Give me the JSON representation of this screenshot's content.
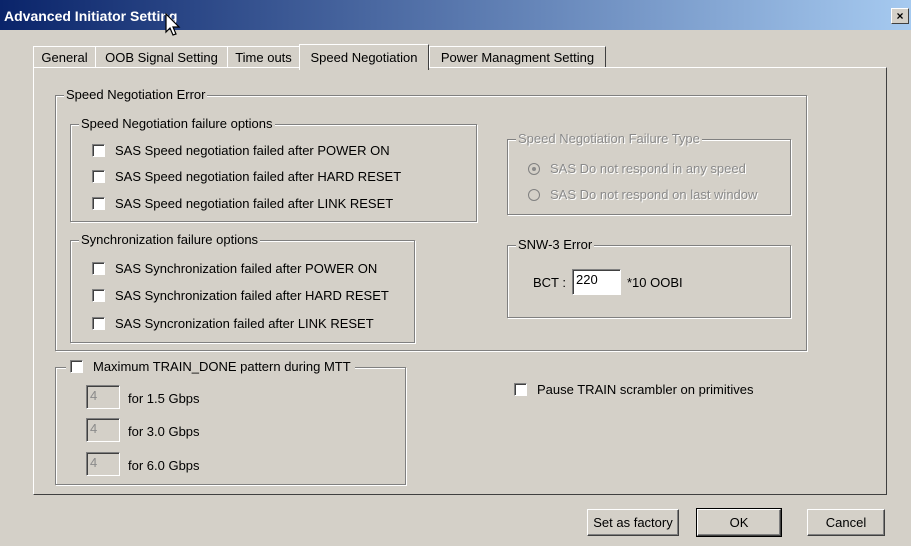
{
  "window": {
    "title": "Advanced Initiator Setting",
    "close_glyph": "×"
  },
  "tabs": [
    {
      "label": "General"
    },
    {
      "label": "OOB Signal Setting"
    },
    {
      "label": "Time outs"
    },
    {
      "label": "Speed Negotiation"
    },
    {
      "label": "Power Managment Setting"
    }
  ],
  "active_tab": "Speed Negotiation",
  "speed_neg_error": {
    "title": "Speed Negotiation Error",
    "failure_options": {
      "title": "Speed Negotiation failure options",
      "items": [
        {
          "label": "SAS Speed negotiation failed after POWER ON",
          "checked": false
        },
        {
          "label": "SAS Speed negotiation failed after HARD RESET",
          "checked": false
        },
        {
          "label": "SAS Speed negotiation failed after LINK RESET",
          "checked": false
        }
      ]
    },
    "failure_type": {
      "title": "Speed Negotiation Failure Type",
      "options": [
        {
          "label": "SAS Do not respond in any speed",
          "selected": true
        },
        {
          "label": "SAS Do not respond on last window",
          "selected": false
        }
      ]
    },
    "sync_options": {
      "title": "Synchronization failure options",
      "items": [
        {
          "label": "SAS Synchronization failed after POWER ON",
          "checked": false
        },
        {
          "label": "SAS Synchronization failed after HARD RESET",
          "checked": false
        },
        {
          "label": "SAS Syncronization failed after LINK RESET",
          "checked": false
        }
      ]
    },
    "snw3": {
      "title": "SNW-3 Error",
      "bct_label": "BCT :",
      "bct_value": "220",
      "unit": "*10 OOBI"
    }
  },
  "train_done": {
    "label": "Maximum TRAIN_DONE pattern during MTT",
    "checked": false,
    "rows": [
      {
        "value": "4",
        "label": "for 1.5 Gbps"
      },
      {
        "value": "4",
        "label": "for 3.0 Gbps"
      },
      {
        "value": "4",
        "label": "for 6.0 Gbps"
      }
    ]
  },
  "pause_train": {
    "label": "Pause TRAIN scrambler on primitives",
    "checked": false
  },
  "buttons": {
    "factory": "Set as factory",
    "ok": "OK",
    "cancel": "Cancel"
  }
}
